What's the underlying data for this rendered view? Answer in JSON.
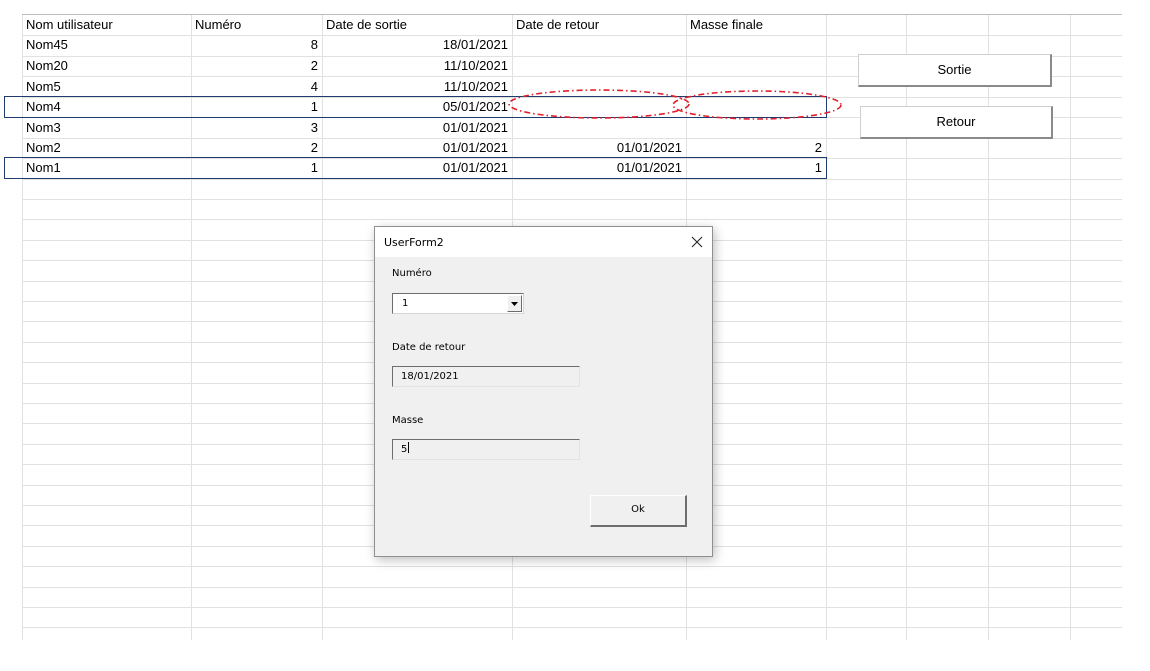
{
  "sheet": {
    "headers": [
      "Nom utilisateur",
      "Numéro",
      "Date de sortie",
      "Date de retour",
      "Masse finale"
    ],
    "rows": [
      {
        "nom": "Nom45",
        "numero": "8",
        "sortie": "18/01/2021",
        "retour": "",
        "masse": ""
      },
      {
        "nom": "Nom20",
        "numero": "2",
        "sortie": "11/10/2021",
        "retour": "",
        "masse": ""
      },
      {
        "nom": "Nom5",
        "numero": "4",
        "sortie": "11/10/2021",
        "retour": "",
        "masse": ""
      },
      {
        "nom": "Nom4",
        "numero": "1",
        "sortie": "05/01/2021",
        "retour": "",
        "masse": ""
      },
      {
        "nom": "Nom3",
        "numero": "3",
        "sortie": "01/01/2021",
        "retour": "",
        "masse": ""
      },
      {
        "nom": "Nom2",
        "numero": "2",
        "sortie": "01/01/2021",
        "retour": "01/01/2021",
        "masse": "2"
      },
      {
        "nom": "Nom1",
        "numero": "1",
        "sortie": "01/01/2021",
        "retour": "01/01/2021",
        "masse": "1"
      }
    ],
    "buttons": {
      "sortie": "Sortie",
      "retour": "Retour"
    },
    "selection_color": "#1f3c6e",
    "annotation_color": "#e0202a"
  },
  "dialog": {
    "title": "UserForm2",
    "numero_label": "Numéro",
    "numero_value": "1",
    "date_label": "Date de retour",
    "date_value": "18/01/2021",
    "masse_label": "Masse",
    "masse_value": "5",
    "ok_label": "Ok"
  }
}
